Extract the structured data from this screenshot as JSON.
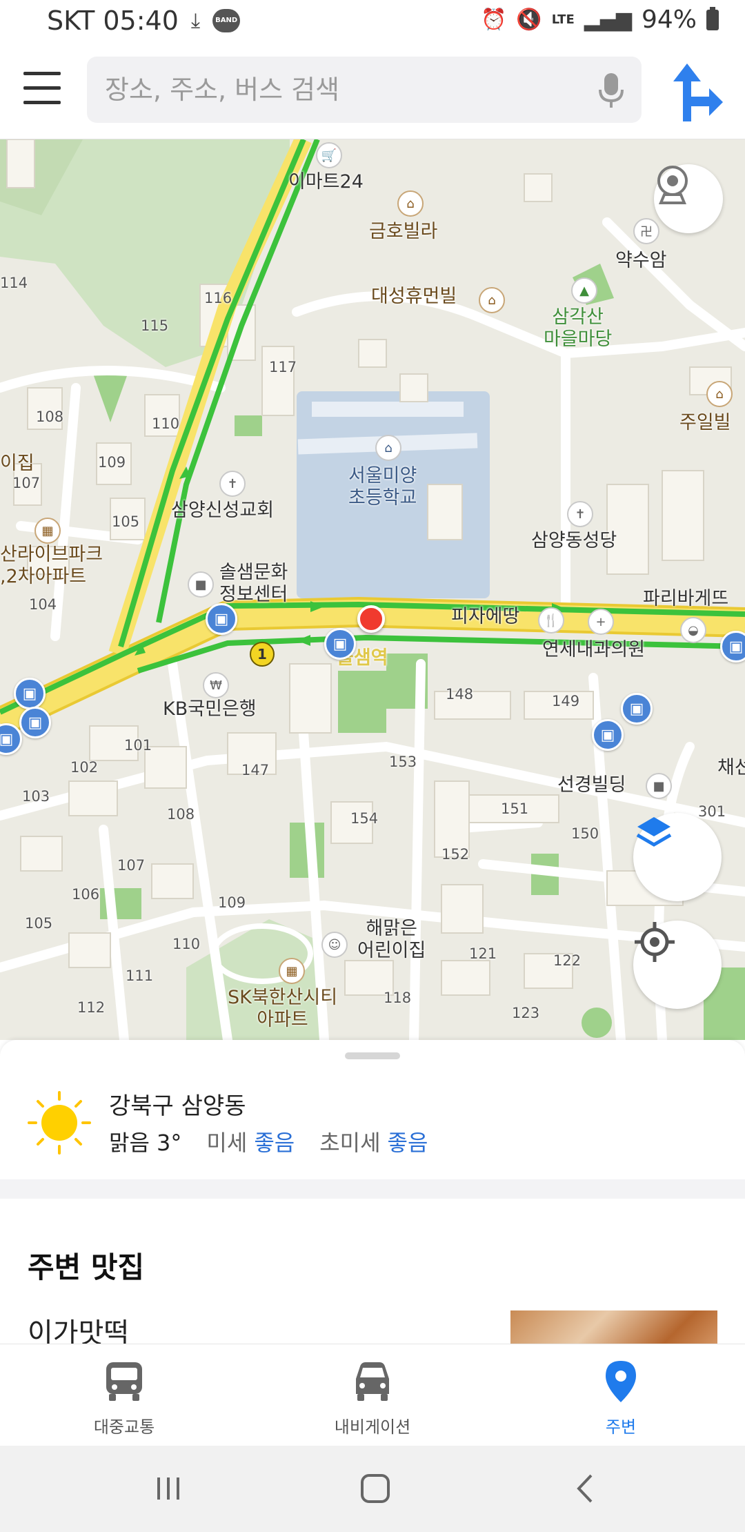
{
  "status_bar": {
    "carrier_time": "SKT 05:40",
    "band_label": "BAND",
    "network": "LTE",
    "battery": "94%"
  },
  "search": {
    "placeholder": "장소, 주소, 버스 검색"
  },
  "map": {
    "labels": {
      "emart24": "이마트24",
      "geumho": "금호빌라",
      "yaksuam": "약수암",
      "daesung": "대성휴먼빌",
      "samgaksan": "삼각산\n마을마당",
      "juil": "주일빌",
      "school": "서울미양\n초등학교",
      "church": "삼양신성교회",
      "cathedral": "삼양동성당",
      "apt_left": "산라이브파크\n,2차아파트",
      "ijip": "이집",
      "solsaem": "솔샘문화\n정보센터",
      "pizza": "피자에땅",
      "paris": "파리바게뜨",
      "yonsei": "연세내과의원",
      "station": "솔샘역",
      "kb": "KB국민은행",
      "seonkyung": "선경빌딩",
      "chae": "채선",
      "haemalgeun": "해맑은\n어린이집",
      "sk": "SK북한산시티\n아파트"
    },
    "line_badge": "1",
    "building_numbers": [
      "114",
      "116",
      "115",
      "117",
      "108",
      "110",
      "109",
      "107",
      "105",
      "104",
      "148",
      "149",
      "153",
      "147",
      "101",
      "102",
      "103",
      "108",
      "151",
      "150",
      "154",
      "152",
      "301",
      "107",
      "106",
      "109",
      "105",
      "110",
      "111",
      "112",
      "121",
      "122",
      "118",
      "123"
    ]
  },
  "weather": {
    "location": "강북구 삼양동",
    "condition": "맑음 3°",
    "dust_label": "미세",
    "dust_value": "좋음",
    "fine_dust_label": "초미세",
    "fine_dust_value": "좋음"
  },
  "nearby": {
    "title": "주변 맛집",
    "first_item": "이가맛떡"
  },
  "bottom_nav": {
    "transit": "대중교통",
    "navigation": "내비게이션",
    "around": "주변"
  },
  "colors": {
    "accent": "#1f7bec",
    "bus_stop": "#4a84d6",
    "road_main": "#f8e36a",
    "route_green": "#3cc23c"
  }
}
